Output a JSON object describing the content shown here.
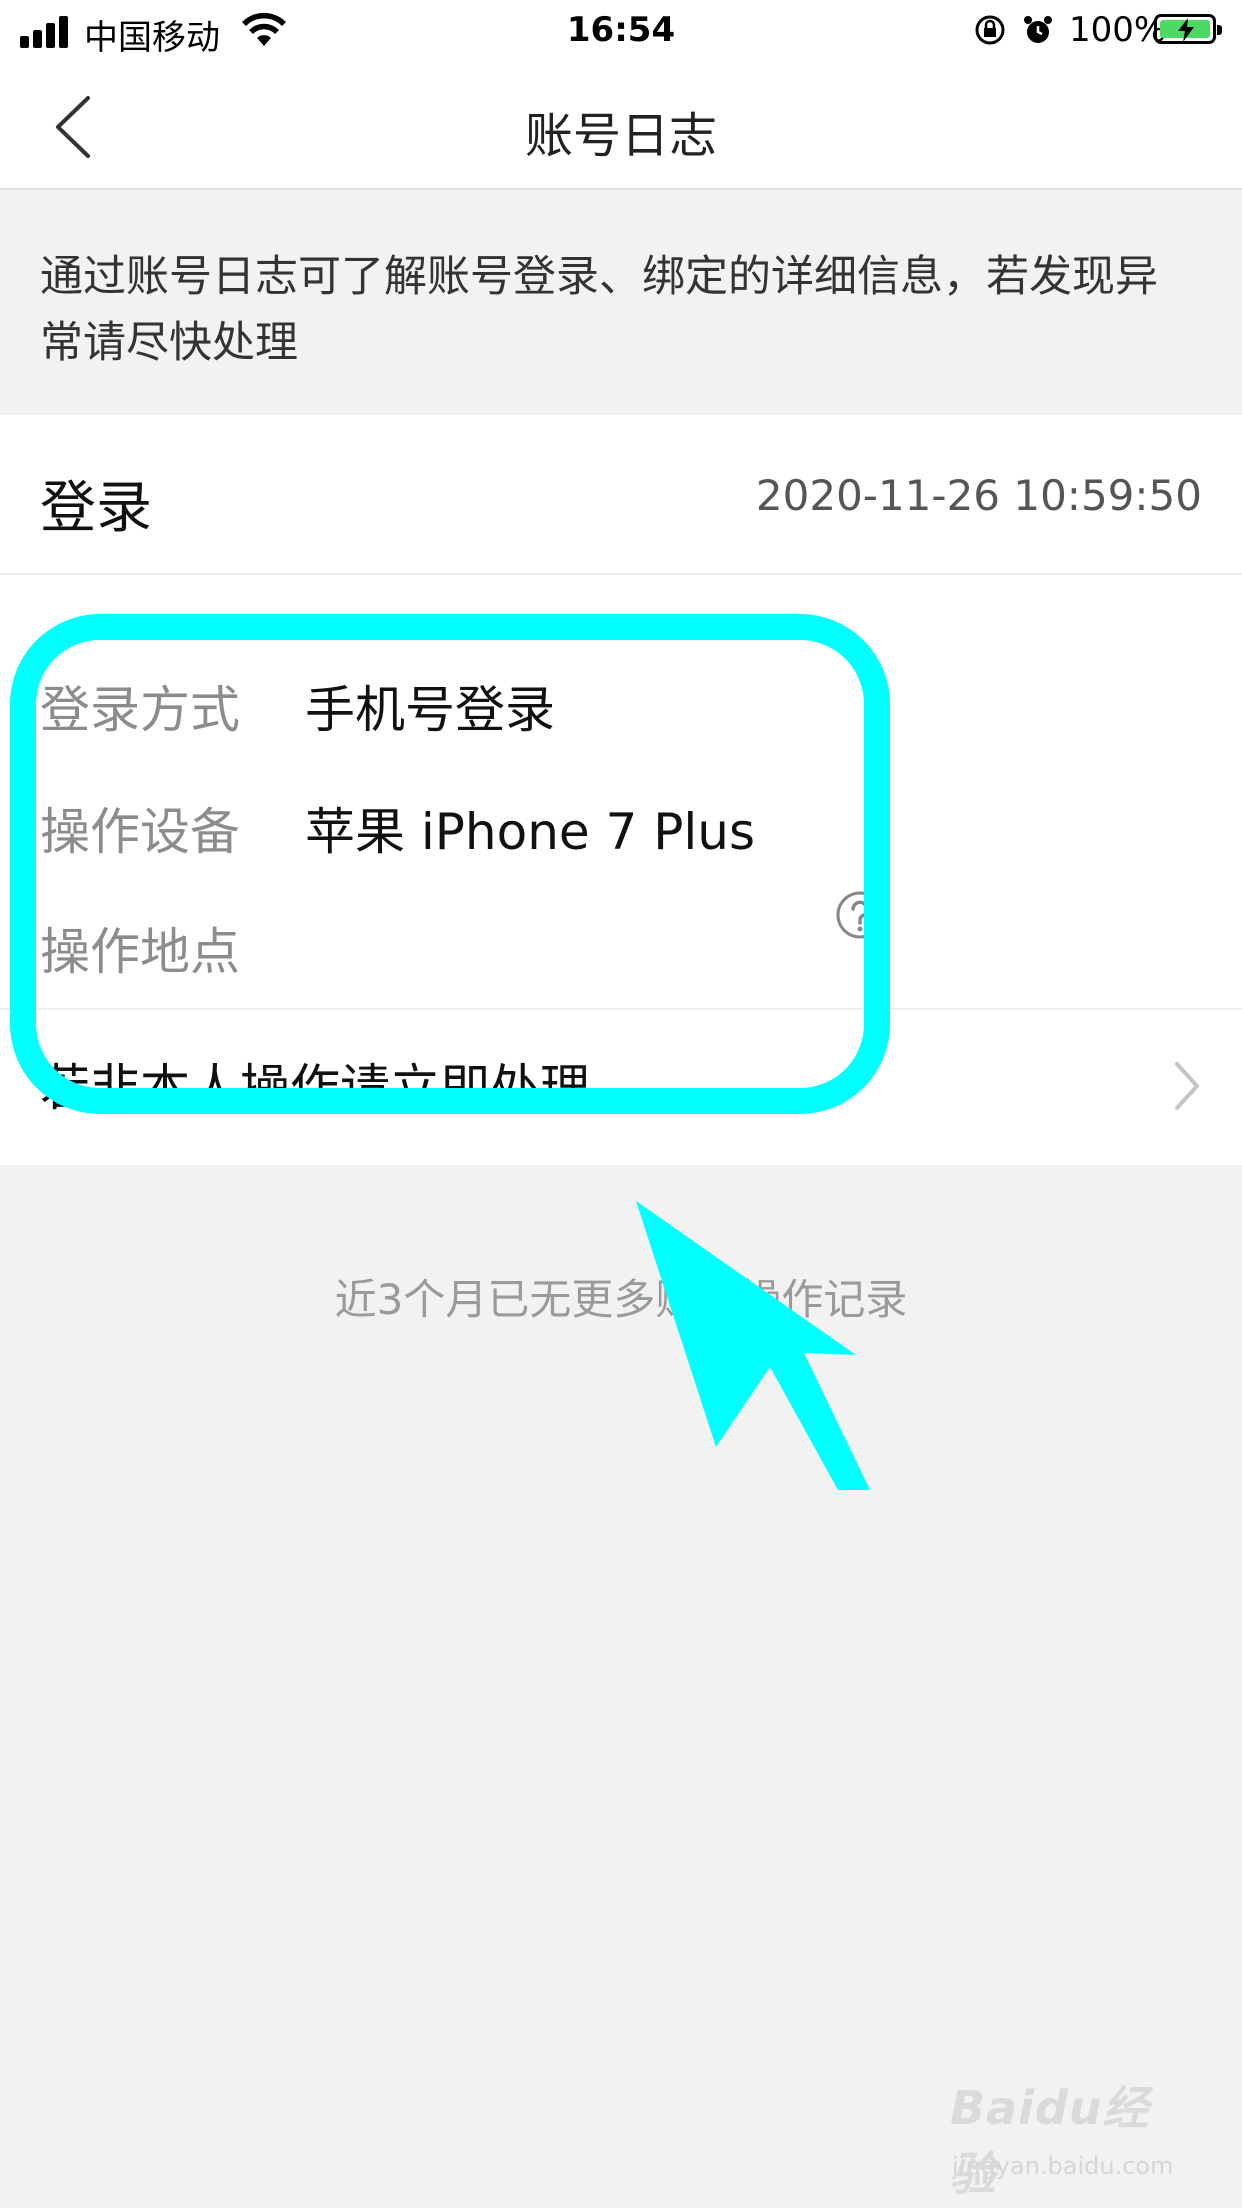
{
  "status_bar": {
    "carrier": "中国移动",
    "time": "16:54",
    "battery_percent": "100%",
    "icons": [
      "signal-icon",
      "wifi-icon",
      "rotation-lock-icon",
      "alarm-icon",
      "battery-charging-icon"
    ]
  },
  "nav": {
    "title": "账号日志",
    "back_icon": "chevron-left-icon"
  },
  "banner": {
    "text": "通过账号日志可了解账号登录、绑定的详细信息，若发现异常请尽快处理"
  },
  "log_entry": {
    "type": "登录",
    "timestamp": "2020-11-26 10:59:50",
    "details": [
      {
        "label": "登录方式",
        "value": "手机号登录"
      },
      {
        "label": "操作设备",
        "value": "苹果 iPhone 7 Plus"
      },
      {
        "label": "操作地点",
        "value": ""
      }
    ],
    "help_icon": "question-circle-icon",
    "action_label": "若非本人操作请立即处理",
    "action_icon": "chevron-right-icon"
  },
  "footer": {
    "text": "近3个月已无更多账号操作记录"
  },
  "annotation": {
    "color": "#00ffff"
  },
  "watermark": {
    "logo": "Baidu经验",
    "url": "jingyan.baidu.com"
  }
}
